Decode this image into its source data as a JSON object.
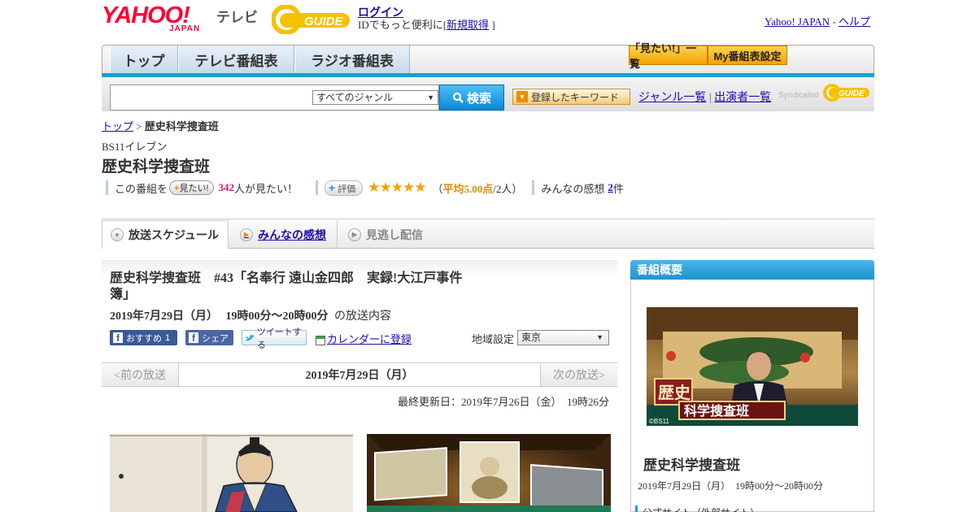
{
  "header": {
    "logo_yahoo": "YAHOO!",
    "logo_japan": "JAPAN",
    "logo_tv": "テレビ",
    "logo_gguide": "GUIDE",
    "login": "ログイン",
    "login_sub_prefix": "IDでもっと便利に[",
    "register": "新規取得",
    "login_sub_suffix": "]",
    "yahoo_japan_link": "Yahoo! JAPAN",
    "separator": "-",
    "help_link": "ヘルプ"
  },
  "nav": {
    "tabs": [
      "トップ",
      "テレビ番組表",
      "ラジオ番組表"
    ],
    "want_list": "「見たい!」一覧",
    "my_schedule": "My番組表設定"
  },
  "search": {
    "genre_selected": "すべてのジャンル",
    "button": "検索",
    "keyword_btn": "登録したキーワード",
    "genre_list": "ジャンル一覧",
    "divider": "|",
    "cast_list": "出演者一覧",
    "syndicated": "Syndicated"
  },
  "breadcrumb": {
    "top": "トップ",
    "sep": ">",
    "current": "歴史科学捜査班"
  },
  "program": {
    "channel": "BS11イレブン",
    "title": "歴史科学捜査班",
    "want_prefix": "この番組を",
    "want_button": "見たい!",
    "want_count": "342",
    "want_suffix": "人が見たい！",
    "eval_button": "評価",
    "stars": "★★★★★",
    "avg_open": "（",
    "avg": "平均5.00点",
    "avg_close": "/2人）",
    "impressions_label": "みんなの感想",
    "impressions_count": "2",
    "impressions_unit": "件"
  },
  "tabs": {
    "schedule": "放送スケジュール",
    "impressions": "みんなの感想",
    "missed": "見逃し配信"
  },
  "episode": {
    "title": "歴史科学捜査班　#43「名奉行 遠山金四郎　実録!大江戸事件簿」",
    "date": "2019年7月29日（月）",
    "time": "19時00分～20時00分",
    "date_suffix": "の放送内容",
    "fb_recommend": "おすすめ",
    "fb_recommend_count": "1",
    "fb_share": "シェア",
    "tweet": "ツイートする",
    "calendar": "カレンダーに登録",
    "region_label": "地域設定",
    "region_value": "東京"
  },
  "pager": {
    "prev": "<前の放送",
    "date": "2019年7月29日（月）",
    "next": "次の放送>"
  },
  "updated": "最終更新日：2019年7月26日（金）　19時26分",
  "sidebar": {
    "header": "番組概要",
    "image_caption": "©BS11",
    "image_text_1": "歴史",
    "image_text_2": "科学捜査班",
    "title": "歴史科学捜査班",
    "time": "2019年7月29日（月）　19時00分～20時00分",
    "official": "公式サイト（外部サイト）"
  },
  "colors": {
    "accent_blue": "#1a9ed8",
    "yahoo_red": "#ff0033",
    "orange": "#f5a300",
    "link": "#1a0dab"
  }
}
